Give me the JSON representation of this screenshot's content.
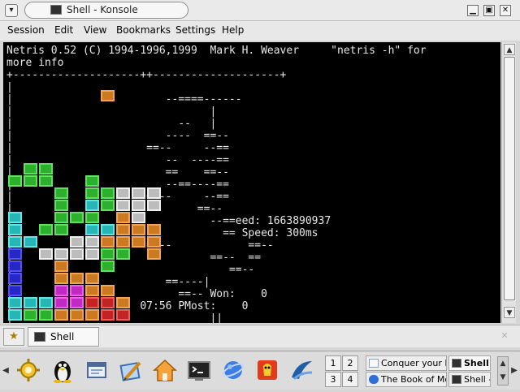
{
  "window": {
    "title": "Shell - Konsole",
    "menu_button_glyph": "▾",
    "minimize_glyph": "▁",
    "maximize_glyph": "▣",
    "close_glyph": "✕"
  },
  "menubar": {
    "items": [
      "Session",
      "Edit",
      "View",
      "Bookmarks",
      "Settings",
      "Help"
    ]
  },
  "terminal": {
    "header_line1": "Netris 0.52 (C) 1994-1996,1999  Mark H. Weaver     \"netris -h\" for",
    "header_line2": "more info",
    "board_border": "+--------------------++--------------------+",
    "board_rows": [
      "",
      "                         --====------",
      "                                |",
      "                           --   |",
      "                         ----  ==--",
      "                      ==--     --==",
      "                         --  ----==",
      "                         ==    ==--",
      "                         --==----==",
      "                      ==--     --==",
      "                    --        ==--",
      "                                --==eed: 1663890937",
      "                                  == Speed: 300ms",
      "                      ==--            ==--",
      "                                ==--  ==",
      "                                   ==--",
      "                         ==----|",
      "                           ==-- Won:    0",
      "                     07:56 PMost:    0",
      "                                ||"
    ]
  },
  "scrollbar": {
    "up_glyph": "▲",
    "down_glyph": "▼"
  },
  "tabbar": {
    "new_session_glyph": "★",
    "tab_label": "Shell",
    "close_glyph": "✕"
  },
  "panel": {
    "left_arrow": "◀",
    "right_arrow": "▶",
    "desktops": [
      "1",
      "2",
      "3",
      "4"
    ],
    "tasks": [
      {
        "label": "Conquer your D"
      },
      {
        "label": "Shell -"
      },
      {
        "label": "The Book of Mo"
      },
      {
        "label": "Shell -"
      }
    ],
    "launchers": [
      "kde-gear-icon",
      "penguin-icon",
      "window-list-icon",
      "edit-icon",
      "home-icon",
      "terminal-icon",
      "browser-icon",
      "game-icon",
      "office-icon"
    ]
  }
}
